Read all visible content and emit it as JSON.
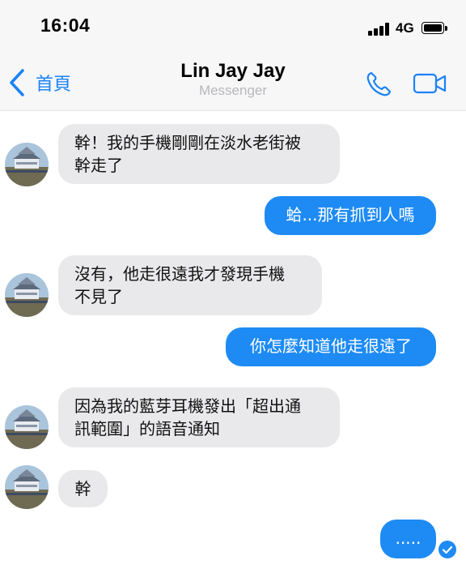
{
  "status_bar": {
    "time": "16:04",
    "network": "4G"
  },
  "header": {
    "back_label": "首頁",
    "contact_name": "Lin Jay Jay",
    "app_name": "Messenger"
  },
  "messages": [
    {
      "from": "them",
      "text": "幹！我的手機剛剛在淡水老街被\n幹走了"
    },
    {
      "from": "me",
      "text": "蛤...那有抓到人嗎"
    },
    {
      "from": "them",
      "text": "沒有，他走很遠我才發現手機\n不見了"
    },
    {
      "from": "me",
      "text": "你怎麼知道他走很遠了"
    },
    {
      "from": "them",
      "text": "因為我的藍芽耳機發出「超出通\n訊範圍」的語音通知"
    },
    {
      "from": "them",
      "text": "幹"
    },
    {
      "from": "me",
      "text": "....."
    }
  ],
  "colors": {
    "accent": "#1e8bf5",
    "incoming_bubble": "#e9e9eb"
  },
  "icons": [
    "back-chevron-icon",
    "phone-icon",
    "video-camera-icon",
    "seen-check-icon",
    "signal-icon",
    "battery-icon"
  ]
}
